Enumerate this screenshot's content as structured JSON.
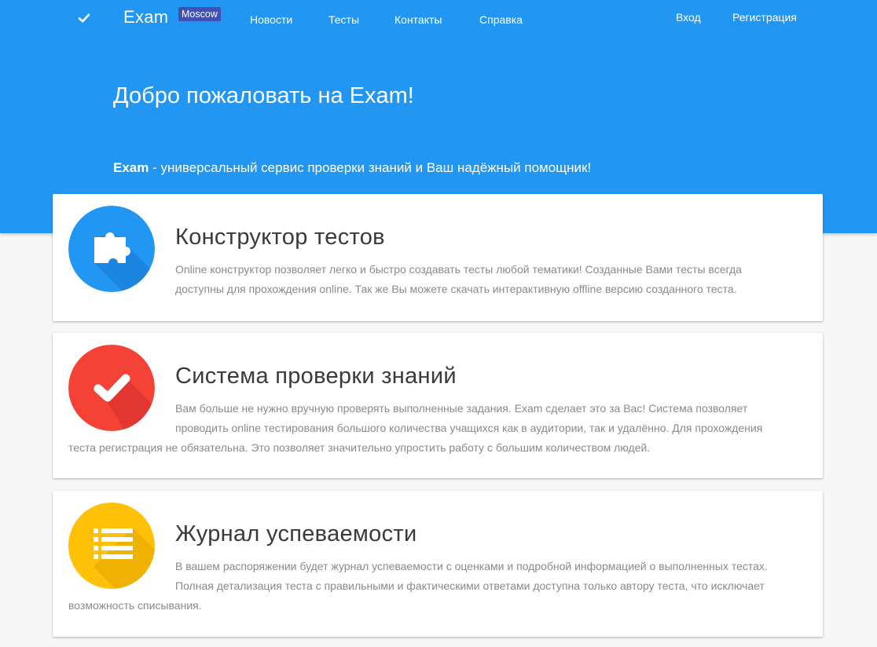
{
  "navbar": {
    "brand": "Exam",
    "badge": "Moscow",
    "links": [
      "Новости",
      "Тесты",
      "Контакты",
      "Справка"
    ],
    "auth": {
      "login": "Вход",
      "register": "Регистрация"
    }
  },
  "hero": {
    "title": "Добро пожаловать на Exam!",
    "lead_brand": "Exam",
    "lead_text": " - универсальный сервис проверки знаний и Ваш надёжный помощник!"
  },
  "cards": [
    {
      "icon": "puzzle-icon",
      "color": "#2196f3",
      "title": "Конструктор тестов",
      "text": "Online конструктор позволяет легко и быстро создавать тесты любой тематики! Созданные Вами тесты всегда доступны для прохождения online. Так же Вы можете скачать интерактивную offline версию созданного теста."
    },
    {
      "icon": "check-icon",
      "color": "#f44336",
      "title": "Система проверки знаний",
      "text": "Вам больше не нужно вручную проверять выполненные задания. Exam сделает это за Вас! Система позволяет проводить online тестирования большого количества учащихся как в аудитории, так и удалённо. Для прохождения теста регистрация не обязательна. Это позволяет значительно упростить работу с большим количеством людей."
    },
    {
      "icon": "list-icon",
      "color": "#ffc107",
      "title": "Журнал успеваемости",
      "text": "В вашем распоряжении будет журнал успеваемости с оценками и подробной информацией о выполненных тестах. Полная детализация теста с правильными и фактическими ответами доступна только автору теста, что исключает возможность списывания."
    }
  ]
}
